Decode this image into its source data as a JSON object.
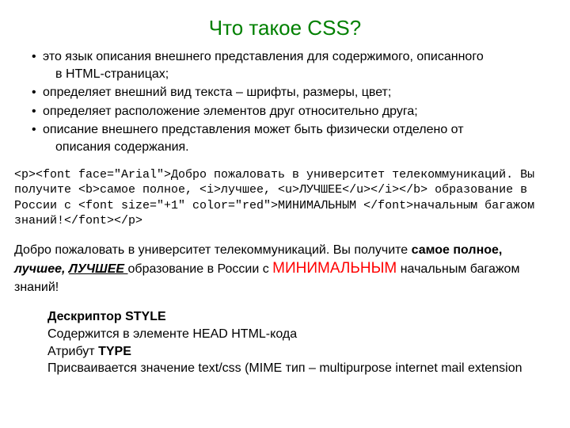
{
  "title": "Что такое CSS?",
  "bullets": {
    "b1_a": "это язык описания внешнего представления для содержимого, описанного",
    "b1_b": "в HTML-страницах;",
    "b2": "определяет внешний вид текста – шрифты, размеры, цвет;",
    "b3": "определяет расположение элементов друг относительно друга;",
    "b4_a": "описание внешнего представления может быть физически отделено от",
    "b4_b": "описания содержания."
  },
  "code": "<p><font face=\"Arial\">Добро пожаловать в университет телекоммуникаций. Вы получите <b>самое полное, <i>лучшее, <u>ЛУЧШЕЕ</u></i></b> образование в России с <font size=\"+1\" color=\"red\">МИНИМАЛЬНЫМ </font>начальным багажом знаний!</font></p>",
  "rendered": {
    "lead": "Добро пожаловать в университет телекоммуникаций. Вы получите ",
    "bold1": "самое полное, ",
    "italic": "лучшее, ",
    "underline": "ЛУЧШЕЕ ",
    "mid": "образование в России с ",
    "red": "МИНИМАЛЬНЫМ",
    "tail": " начальным багажом знаний!"
  },
  "style_block": {
    "l1_strong": "Дескриптор STYLE",
    "l2": "Содержится в элементе HEAD HTML-кода",
    "l3_a": "Атрибут ",
    "l3_strong": "TYPE",
    "l4": "Присваивается значение text/css (MIME тип – multipurpose internet mail extension"
  },
  "bullet_char": "•"
}
